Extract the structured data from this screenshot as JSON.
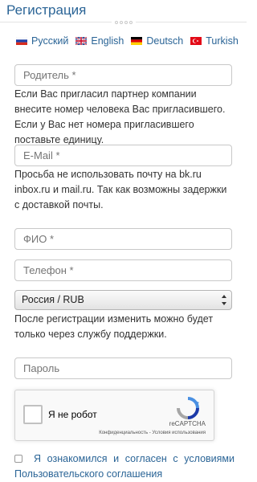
{
  "header": {
    "title": "Регистрация"
  },
  "languages": [
    {
      "label": "Русский",
      "flag": "russia-flag"
    },
    {
      "label": "English",
      "flag": "uk-flag"
    },
    {
      "label": "Deutsch",
      "flag": "germany-flag"
    },
    {
      "label": "Turkish",
      "flag": "turkey-flag"
    }
  ],
  "form": {
    "parent_placeholder": "Родитель *",
    "parent_note": "Если Вас пригласил партнер компании внесите номер человека Вас пригласившего. Если у Вас нет номера пригласившего поставьте единицу.",
    "email_placeholder": "E-Mail *",
    "email_note": "Просьба не использовать почту на bk.ru inbox.ru и mail.ru. Так как возможны задержки с доставкой почты.",
    "fio_placeholder": "ФИО *",
    "phone_placeholder": "Телефон *",
    "country_selected": "Россия / RUB",
    "country_note": "После регистрации изменить можно будет только через службу поддержки.",
    "password_placeholder": "Пароль"
  },
  "recaptcha": {
    "label": "Я не робот",
    "brand": "reCAPTCHA",
    "links": "Конфиденциальность - Условия использования"
  },
  "agreement": {
    "text": "Я ознакомился и согласен с условиями Пользовательского соглашения"
  },
  "colors": {
    "link": "#2a6496",
    "border": "#c8c8c8"
  }
}
